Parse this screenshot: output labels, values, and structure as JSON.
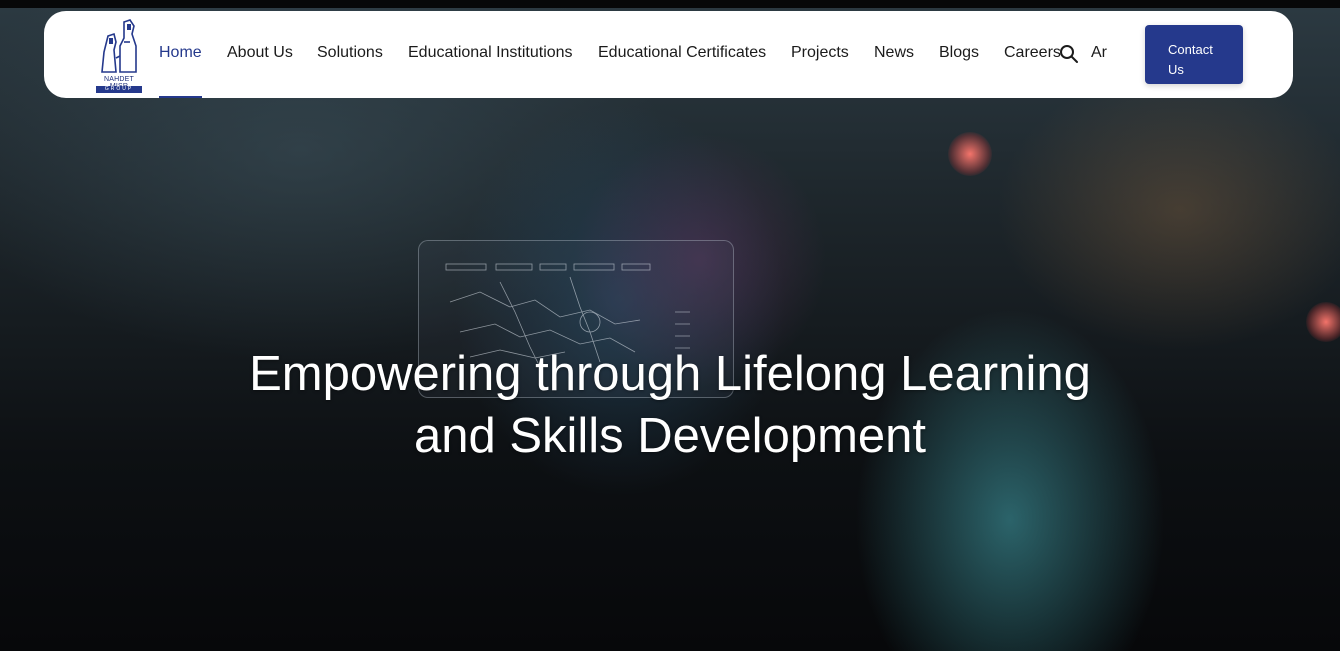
{
  "brand": {
    "logo_text": "NAHDET MISR",
    "logo_subtext": "GROUP",
    "primary_color": "#25398c"
  },
  "nav": {
    "items": [
      {
        "label": "Home",
        "active": true
      },
      {
        "label": "About Us",
        "active": false
      },
      {
        "label": "Solutions",
        "active": false
      },
      {
        "label": "Educational Institutions",
        "active": false
      },
      {
        "label": "Educational Certificates",
        "active": false
      },
      {
        "label": "Projects",
        "active": false
      },
      {
        "label": "News",
        "active": false
      },
      {
        "label": "Blogs",
        "active": false
      },
      {
        "label": "Careers",
        "active": false
      }
    ],
    "search_icon": "search-icon",
    "language_label": "Ar",
    "contact_label": "Contact Us"
  },
  "hero": {
    "title": "Empowering through Lifelong Learning and Skills Development"
  }
}
